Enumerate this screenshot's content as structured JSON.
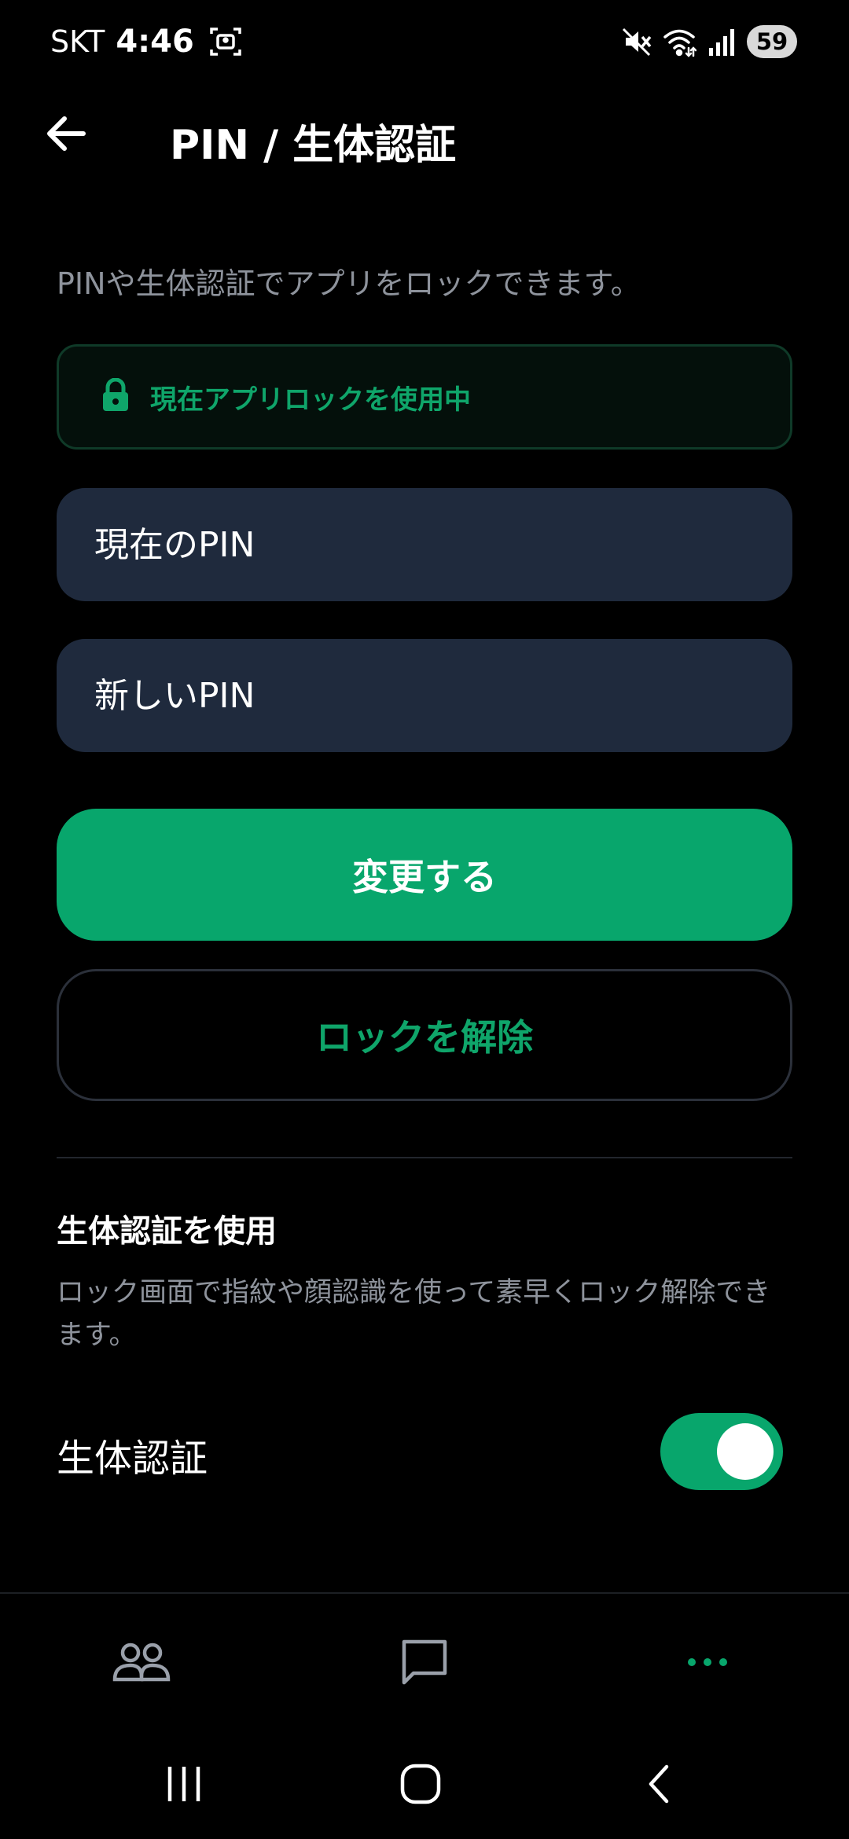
{
  "status_bar": {
    "carrier": "SKT",
    "time": "4:46",
    "battery": "59",
    "icons": [
      "screenshot-icon",
      "mute-icon",
      "wifi-icon",
      "signal-icon"
    ]
  },
  "header": {
    "title": "PIN / 生体認証",
    "back_icon": "arrow-left-icon"
  },
  "description": "PINや生体認証でアプリをロックできます。",
  "lock_status": {
    "icon": "lock-icon",
    "label": "現在アプリロックを使用中"
  },
  "form": {
    "current_pin_placeholder": "現在のPIN",
    "current_pin_value": "",
    "new_pin_placeholder": "新しいPIN",
    "new_pin_value": "",
    "change_button": "変更する",
    "unlock_button": "ロックを解除"
  },
  "biometric_section": {
    "title": "生体認証を使用",
    "description": "ロック画面で指紋や顔認識を使って素早くロック解除できます。",
    "toggle_label": "生体認証",
    "toggle_on": true
  },
  "bottom_nav": {
    "items": [
      {
        "icon": "friends-icon",
        "active": false
      },
      {
        "icon": "chat-icon",
        "active": false
      },
      {
        "icon": "more-icon",
        "active": true
      }
    ]
  },
  "colors": {
    "accent": "#08a66c",
    "accent_text": "#0fa56a",
    "field_bg": "#1f2a3d",
    "muted_text": "#8e939c",
    "inactive_icon": "#9aa0aa"
  }
}
